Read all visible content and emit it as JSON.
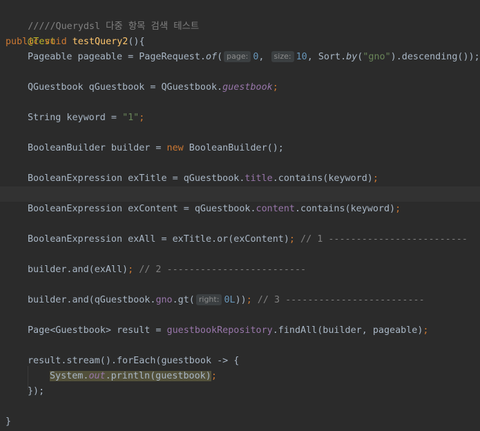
{
  "editor": {
    "comment_line": "/////Querydsl 다중 항목 검색 테스트",
    "annotation": "@Test",
    "method": {
      "kw_public": "public",
      "kw_void": "void",
      "name": "testQuery2",
      "parens_brace": "(){"
    },
    "line_pageable": {
      "decl": "Pageable pageable = PageRequest.",
      "call_of": "of",
      "open": "(",
      "hint_page": "page:",
      "val_page": "0",
      "comma1": ", ",
      "hint_size": "size:",
      "val_size": "10",
      "sort_part": ", Sort.",
      "call_by": "by",
      "open2": "(",
      "str_gno": "\"gno\"",
      "tail": ").descending());"
    },
    "line_qguestbook": {
      "decl": "QGuestbook qGuestbook = QGuestbook.",
      "field": "guestbook",
      "semi": ";"
    },
    "line_keyword": {
      "decl": "String keyword = ",
      "str": "\"1\"",
      "semi": ";"
    },
    "line_builder": {
      "decl": "BooleanBuilder builder = ",
      "kw_new": "new",
      "tail": " BooleanBuilder();"
    },
    "line_extitle": {
      "decl": "BooleanExpression exTitle = qGuestbook.",
      "field": "title",
      "tail": ".contains(keyword)",
      "semi": ";"
    },
    "line_excontent": {
      "decl": "BooleanExpression exContent = qGuestbook.",
      "field": "content",
      "tail": ".contains(keyword)",
      "semi": ";"
    },
    "line_exall": {
      "decl": "BooleanExpression exAll = exTitle.or(exContent)",
      "semi": ";",
      "comment": " // 1 -------------------------"
    },
    "line_and1": {
      "code": "builder.and(exAll)",
      "semi": ";",
      "comment": " // 2 -------------------------"
    },
    "line_and2": {
      "code": "builder.and(qGuestbook.",
      "field": "gno",
      "call": ".gt(",
      "hint_right": "right:",
      "val": "0L",
      "close": "))",
      "semi": ";",
      "comment": " // 3 -------------------------"
    },
    "line_result": {
      "decl": "Page<Guestbook> result = ",
      "field": "guestbookRepository",
      "tail": ".findAll(builder, pageable)",
      "semi": ";"
    },
    "line_stream": {
      "code": "result.stream().forEach(guestbook -> {"
    },
    "line_println": {
      "cls": "System.",
      "field": "out",
      "tail": ".println(guestbook)",
      "semi": ";"
    },
    "line_close_lambda": {
      "code": "});"
    },
    "line_close_method": {
      "code": "}"
    }
  },
  "colors": {
    "background": "#2b2b2b",
    "keyword": "#cc7832",
    "method_name": "#ffc66d",
    "annotation": "#bbb529",
    "string": "#6a8759",
    "number": "#6897bb",
    "comment": "#808080",
    "field": "#9876aa",
    "text": "#a9b7c6"
  }
}
